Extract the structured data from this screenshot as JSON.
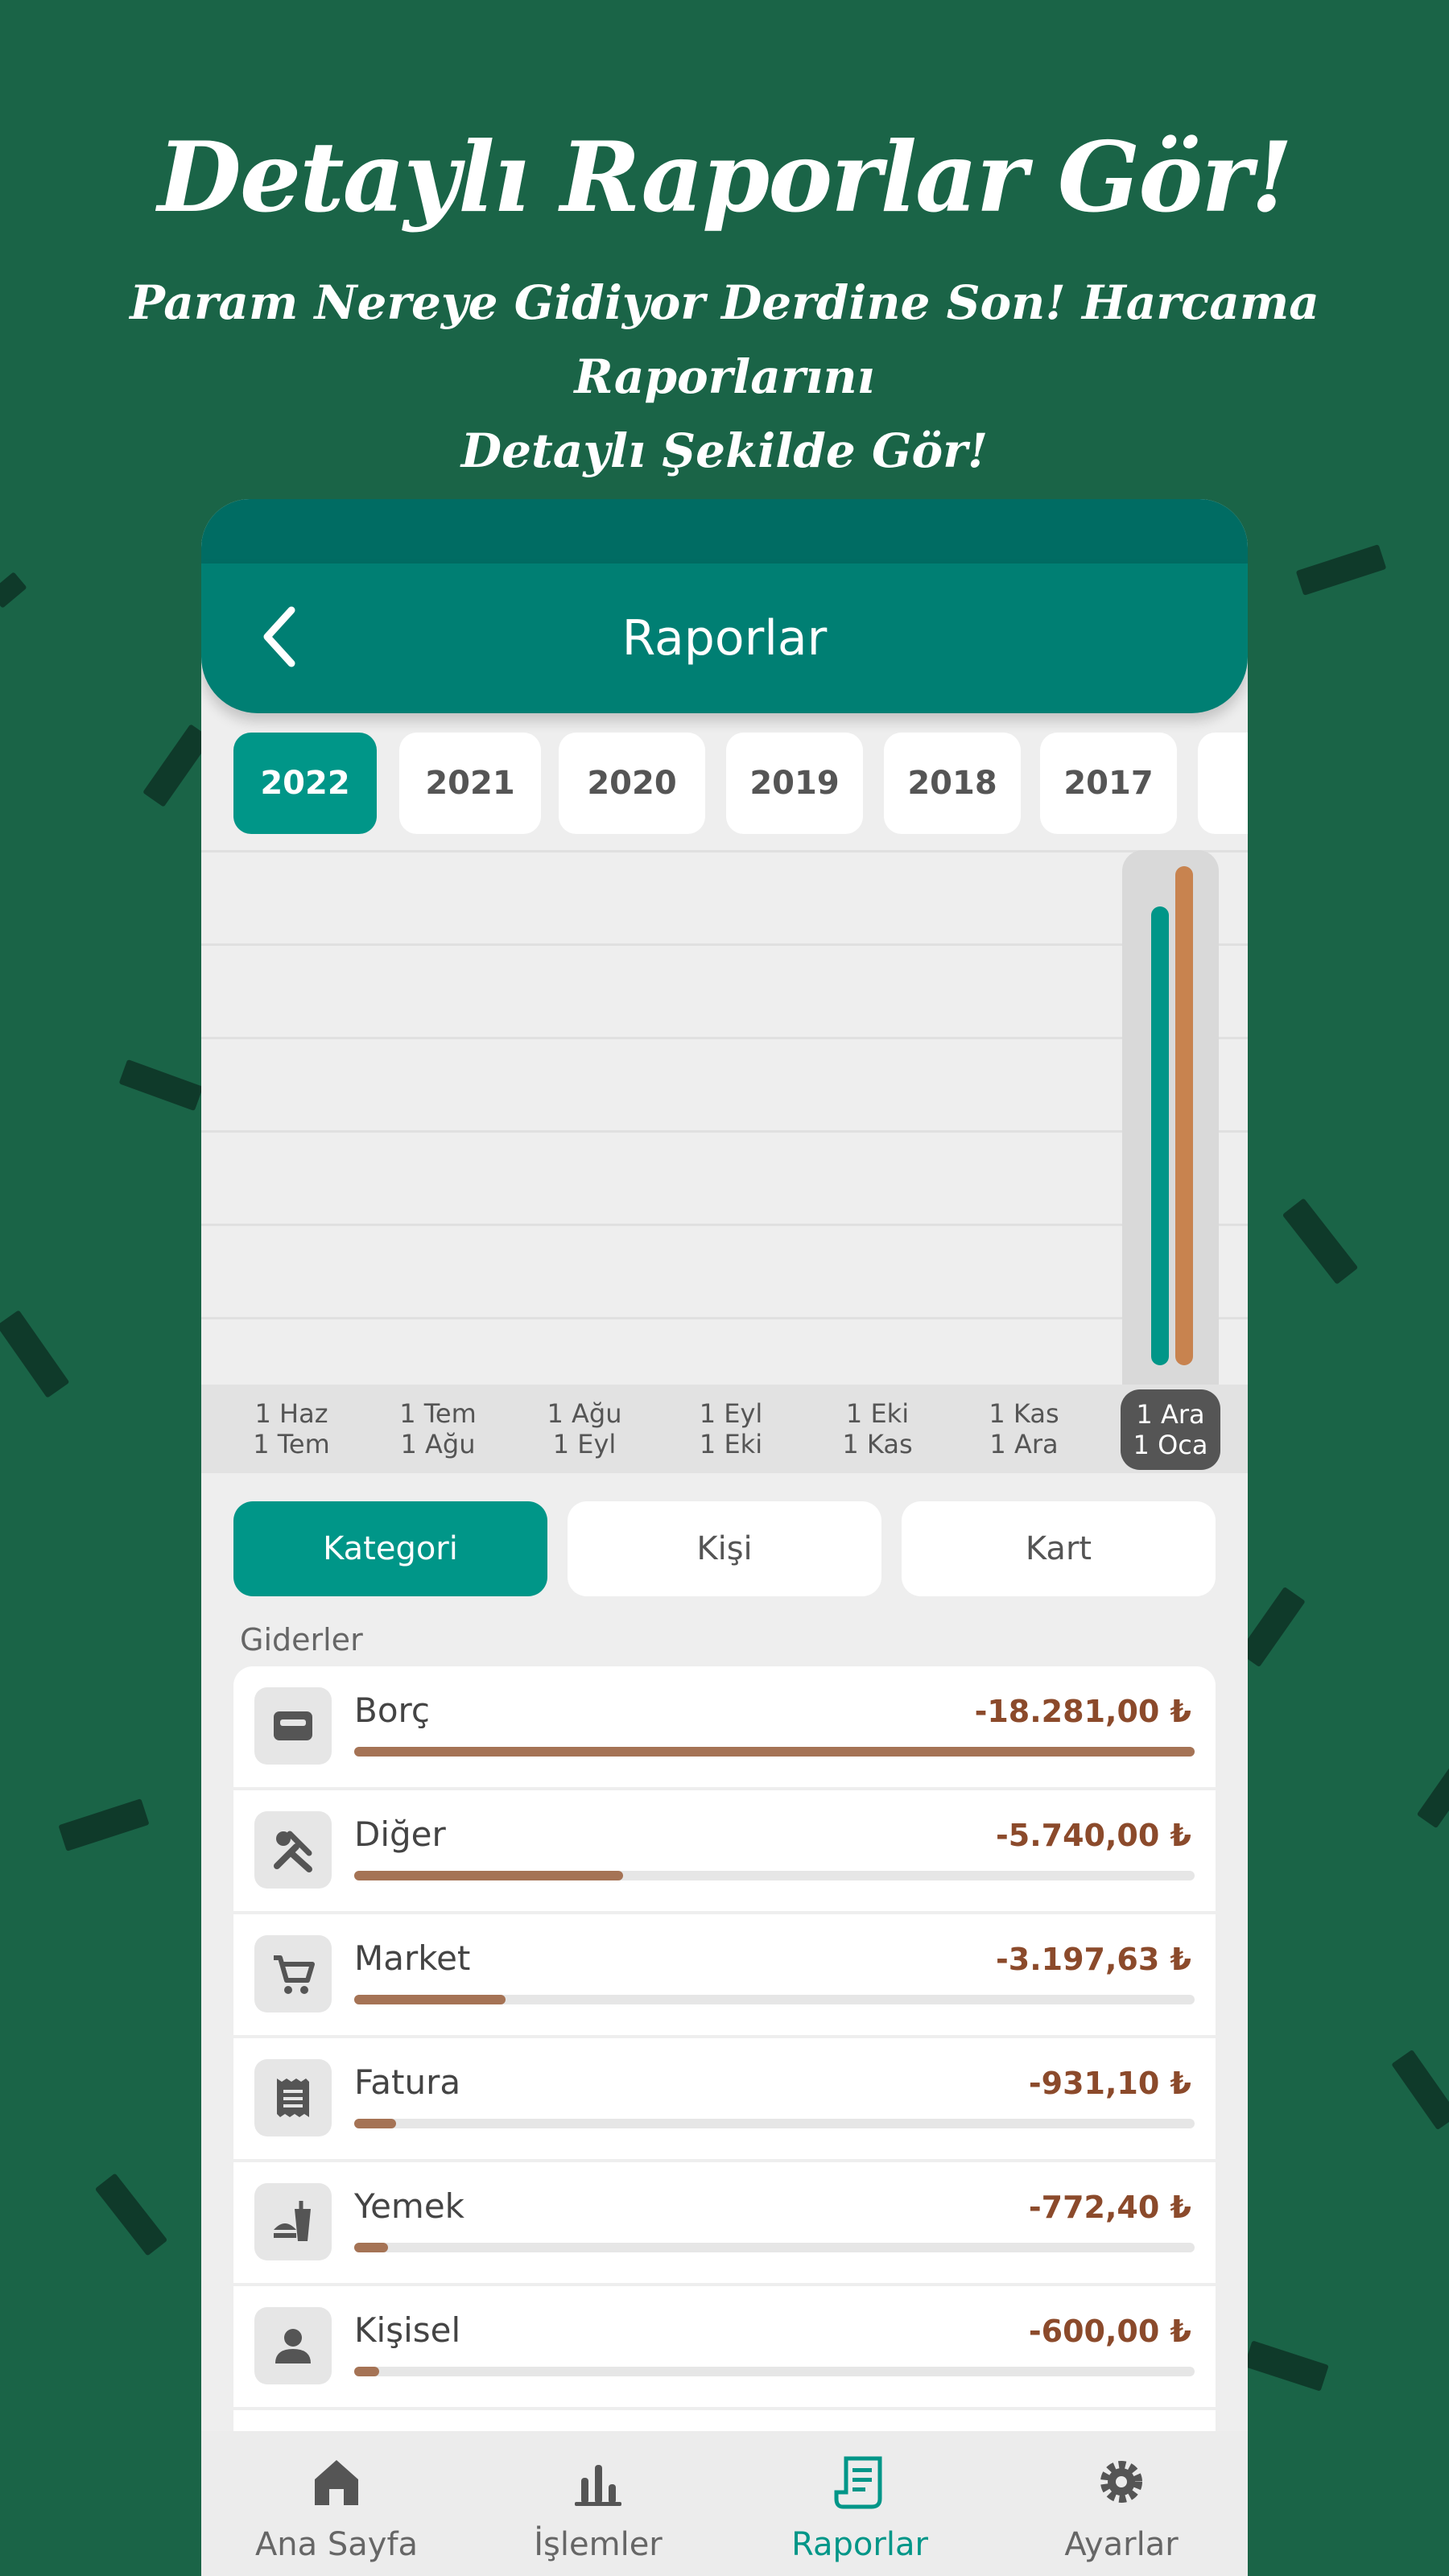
{
  "promo": {
    "title": "Detaylı Raporlar Gör!",
    "subtitle_line1": "Param Nereye Gidiyor Derdine Son! Harcama Raporlarını",
    "subtitle_line2": "Detaylı Şekilde Gör!"
  },
  "header": {
    "title": "Raporlar",
    "back_icon": "chevron-left-icon"
  },
  "year_tabs": [
    {
      "label": "2022",
      "active": true
    },
    {
      "label": "2021",
      "active": false
    },
    {
      "label": "2020",
      "active": false
    },
    {
      "label": "2019",
      "active": false
    },
    {
      "label": "2018",
      "active": false
    },
    {
      "label": "2017",
      "active": false
    }
  ],
  "chart_data": {
    "type": "bar",
    "categories": [
      "1 Haz 1 Tem",
      "1 Tem 1 Ağu",
      "1 Ağu 1 Eyl",
      "1 Eyl 1 Eki",
      "1 Eki 1 Kas",
      "1 Kas 1 Ara",
      "1 Ara 1 Oca"
    ],
    "x_labels": [
      [
        "1 Haz",
        "1 Tem"
      ],
      [
        "1 Tem",
        "1 Ağu"
      ],
      [
        "1 Ağu",
        "1 Eyl"
      ],
      [
        "1 Eyl",
        "1 Eki"
      ],
      [
        "1 Eki",
        "1 Kas"
      ],
      [
        "1 Kas",
        "1 Ara"
      ],
      [
        "1 Ara",
        "1 Oca"
      ]
    ],
    "selected_index": 6,
    "series": [
      {
        "values": [
          0,
          0,
          0,
          0,
          0,
          0,
          0.92
        ],
        "color": "#009688"
      },
      {
        "values": [
          0,
          0,
          0,
          0,
          0,
          0,
          1.0
        ],
        "color": "#c8834f"
      }
    ],
    "ylim": [
      0,
      1
    ],
    "grid": true
  },
  "segments": [
    {
      "label": "Kategori",
      "active": true
    },
    {
      "label": "Kişi",
      "active": false
    },
    {
      "label": "Kart",
      "active": false
    }
  ],
  "section_label": "Giderler",
  "expenses": [
    {
      "name": "Borç",
      "amount": "-18.281,00 ₺",
      "ratio": 1.0,
      "icon": "wallet-icon"
    },
    {
      "name": "Diğer",
      "amount": "-5.740,00 ₺",
      "ratio": 0.32,
      "icon": "tools-icon"
    },
    {
      "name": "Market",
      "amount": "-3.197,63 ₺",
      "ratio": 0.18,
      "icon": "cart-icon"
    },
    {
      "name": "Fatura",
      "amount": "-931,10 ₺",
      "ratio": 0.05,
      "icon": "receipt-icon"
    },
    {
      "name": "Yemek",
      "amount": "-772,40 ₺",
      "ratio": 0.04,
      "icon": "fastfood-icon"
    },
    {
      "name": "Kişisel",
      "amount": "-600,00 ₺",
      "ratio": 0.03,
      "icon": "person-icon"
    }
  ],
  "bottom_nav": [
    {
      "label": "Ana Sayfa",
      "icon": "home-icon",
      "active": false
    },
    {
      "label": "İşlemler",
      "icon": "bar-chart-icon",
      "active": false
    },
    {
      "label": "Raporlar",
      "icon": "report-icon",
      "active": true
    },
    {
      "label": "Ayarlar",
      "icon": "gear-icon",
      "active": false
    }
  ],
  "colors": {
    "background": "#1a6447",
    "accent": "#009688",
    "header": "#007f73",
    "expense": "#8b4a2b",
    "bar_fill": "#a57355"
  }
}
